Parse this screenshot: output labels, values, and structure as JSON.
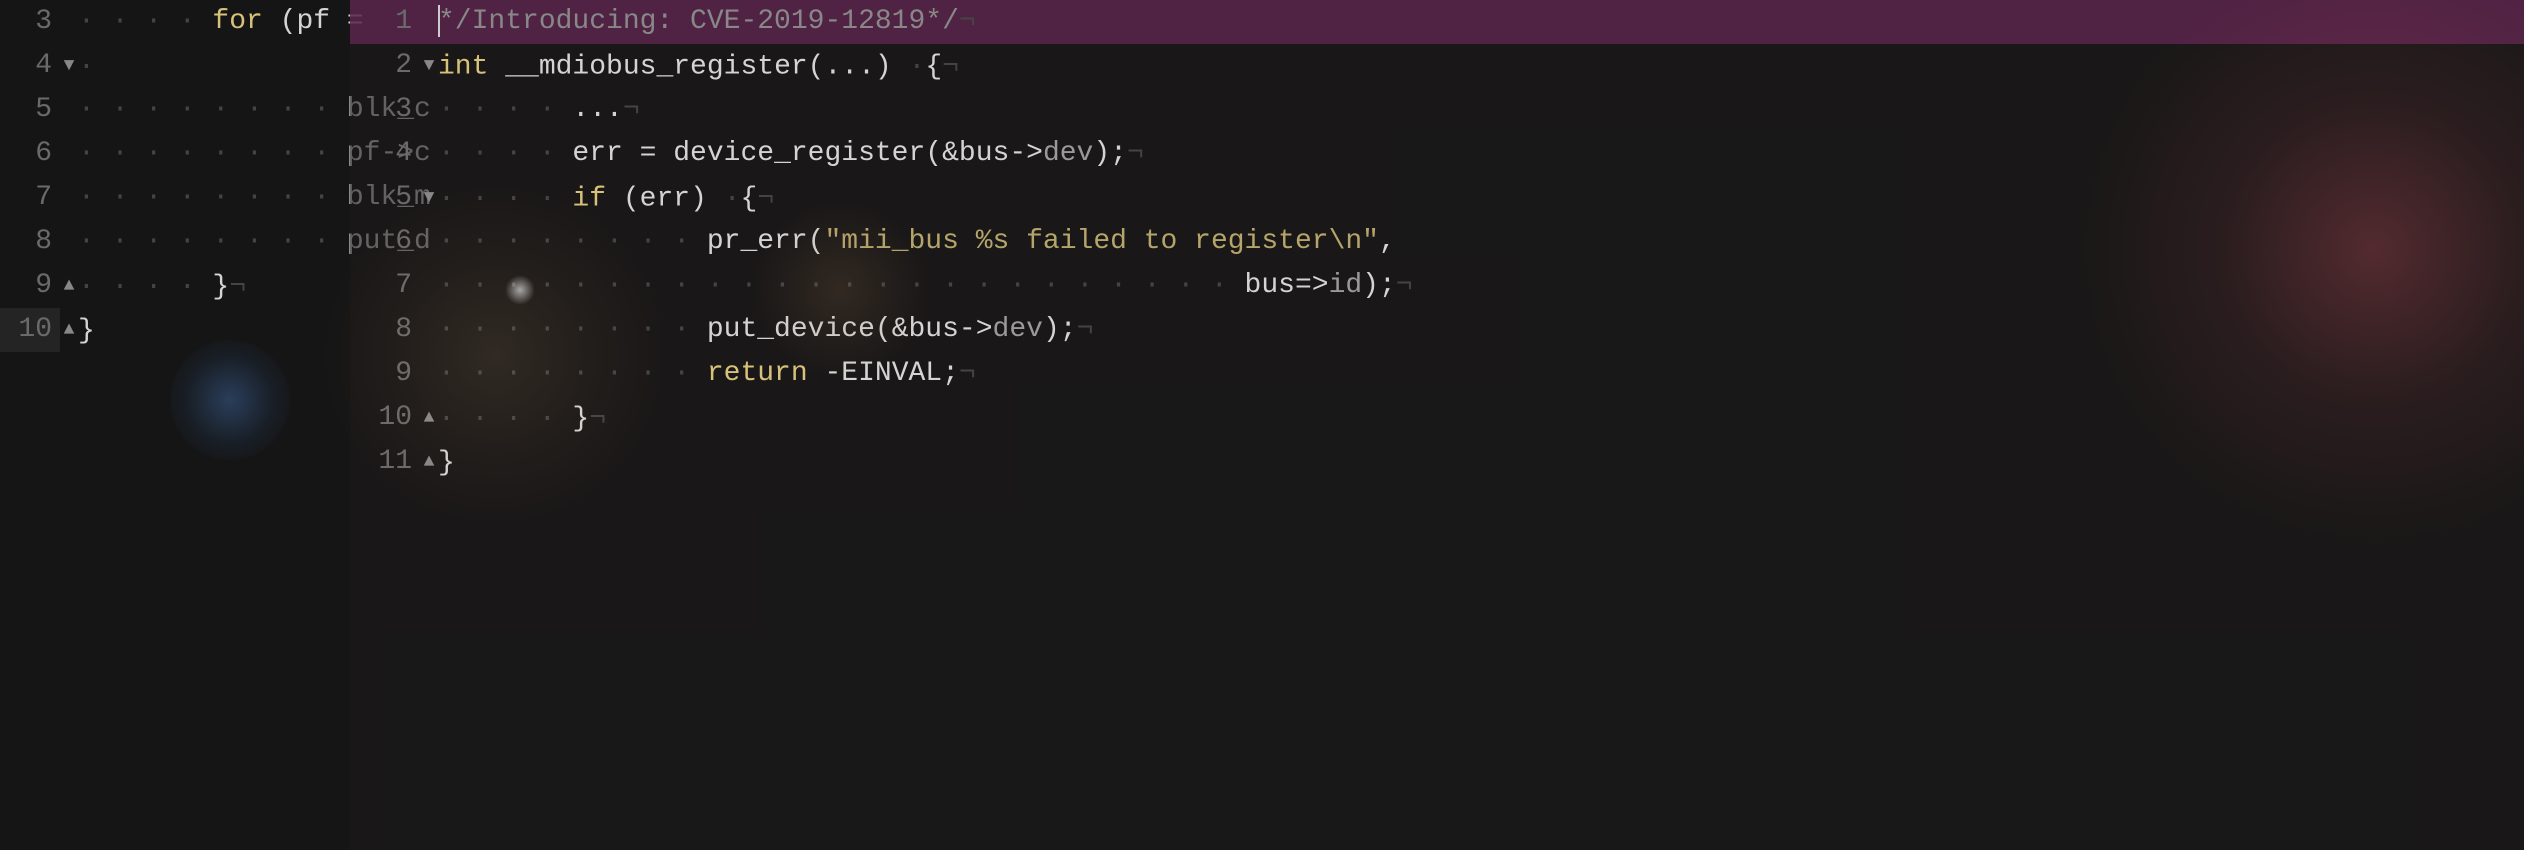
{
  "background_editor": {
    "lines": [
      {
        "num": "3",
        "fold": "",
        "tokens": [
          {
            "t": "ws",
            "v": "· · · · "
          },
          {
            "t": "kw",
            "v": "for "
          },
          {
            "t": "punct",
            "v": "(pf ="
          }
        ]
      },
      {
        "num": "4",
        "fold": "▼",
        "tokens": [
          {
            "t": "ws",
            "v": "· "
          }
        ]
      },
      {
        "num": "5",
        "fold": "",
        "tokens": [
          {
            "t": "ws",
            "v": "· · · · · · · · "
          },
          {
            "t": "ident",
            "v": "blk_c"
          }
        ]
      },
      {
        "num": "6",
        "fold": "",
        "tokens": [
          {
            "t": "ws",
            "v": "· · · · · · · · "
          },
          {
            "t": "ident",
            "v": "pf->c"
          }
        ]
      },
      {
        "num": "7",
        "fold": "",
        "tokens": [
          {
            "t": "ws",
            "v": "· · · · · · · · "
          },
          {
            "t": "ident",
            "v": "blk_m"
          }
        ]
      },
      {
        "num": "8",
        "fold": "",
        "tokens": [
          {
            "t": "ws",
            "v": "· · · · · · · · "
          },
          {
            "t": "ident",
            "v": "put_d"
          }
        ]
      },
      {
        "num": "9",
        "fold": "▲",
        "tokens": [
          {
            "t": "ws",
            "v": "· · · · "
          },
          {
            "t": "punct",
            "v": "}"
          },
          {
            "t": "ws",
            "v": "¬"
          }
        ]
      },
      {
        "num": "10",
        "fold": "▲",
        "tokens": [
          {
            "t": "punct",
            "v": "}"
          }
        ],
        "current": true
      }
    ]
  },
  "foreground_editor": {
    "lines": [
      {
        "num": "1",
        "fold": "",
        "highlight": true,
        "cursor": true,
        "tokens": [
          {
            "t": "comment",
            "v": "*/Introducing: CVE-2019-12819*/"
          },
          {
            "t": "ws",
            "v": "¬"
          }
        ]
      },
      {
        "num": "2",
        "fold": "▼",
        "tokens": [
          {
            "t": "type",
            "v": "int "
          },
          {
            "t": "fn",
            "v": "__mdiobus_register"
          },
          {
            "t": "punct",
            "v": "("
          },
          {
            "t": "op",
            "v": "..."
          },
          {
            "t": "punct",
            "v": ") "
          },
          {
            "t": "ws",
            "v": "·"
          },
          {
            "t": "punct",
            "v": "{"
          },
          {
            "t": "ws",
            "v": "¬"
          }
        ]
      },
      {
        "num": "3",
        "fold": "",
        "tokens": [
          {
            "t": "ws",
            "v": "· · · · "
          },
          {
            "t": "op",
            "v": "..."
          },
          {
            "t": "ws",
            "v": "¬"
          }
        ]
      },
      {
        "num": "4",
        "fold": "",
        "tokens": [
          {
            "t": "ws",
            "v": "· · · · "
          },
          {
            "t": "ident",
            "v": "err "
          },
          {
            "t": "op",
            "v": "= "
          },
          {
            "t": "fn",
            "v": "device_register"
          },
          {
            "t": "punct",
            "v": "("
          },
          {
            "t": "op",
            "v": "&"
          },
          {
            "t": "ident",
            "v": "bus"
          },
          {
            "t": "op",
            "v": "->"
          },
          {
            "t": "field",
            "v": "dev"
          },
          {
            "t": "punct",
            "v": ");"
          },
          {
            "t": "ws",
            "v": "¬"
          }
        ]
      },
      {
        "num": "5",
        "fold": "▼",
        "tokens": [
          {
            "t": "ws",
            "v": "· · · · "
          },
          {
            "t": "kw",
            "v": "if "
          },
          {
            "t": "punct",
            "v": "("
          },
          {
            "t": "ident",
            "v": "err"
          },
          {
            "t": "punct",
            "v": ") "
          },
          {
            "t": "ws",
            "v": "·"
          },
          {
            "t": "punct",
            "v": "{"
          },
          {
            "t": "ws",
            "v": "¬"
          }
        ]
      },
      {
        "num": "6",
        "fold": "",
        "tokens": [
          {
            "t": "ws",
            "v": "· · · · · · · · "
          },
          {
            "t": "fn",
            "v": "pr_err"
          },
          {
            "t": "punct",
            "v": "("
          },
          {
            "t": "str",
            "v": "\"mii_bus %s failed to register\\n\""
          },
          {
            "t": "punct",
            "v": ","
          }
        ]
      },
      {
        "num": "7",
        "fold": "",
        "tokens": [
          {
            "t": "ws",
            "v": "· · · · · · · · · · · · · · · · · · · · · · · · "
          },
          {
            "t": "ident",
            "v": "bus"
          },
          {
            "t": "op",
            "v": "=>"
          },
          {
            "t": "field",
            "v": "id"
          },
          {
            "t": "punct",
            "v": ");"
          },
          {
            "t": "ws",
            "v": "¬"
          }
        ]
      },
      {
        "num": "8",
        "fold": "",
        "tokens": [
          {
            "t": "ws",
            "v": "· · · · · · · · "
          },
          {
            "t": "fn",
            "v": "put_device"
          },
          {
            "t": "punct",
            "v": "("
          },
          {
            "t": "op",
            "v": "&"
          },
          {
            "t": "ident",
            "v": "bus"
          },
          {
            "t": "op",
            "v": "->"
          },
          {
            "t": "field",
            "v": "dev"
          },
          {
            "t": "punct",
            "v": ");"
          },
          {
            "t": "ws",
            "v": "¬"
          }
        ]
      },
      {
        "num": "9",
        "fold": "",
        "tokens": [
          {
            "t": "ws",
            "v": "· · · · · · · · "
          },
          {
            "t": "kw",
            "v": "return "
          },
          {
            "t": "op",
            "v": "-"
          },
          {
            "t": "const",
            "v": "EINVAL"
          },
          {
            "t": "punct",
            "v": ";"
          },
          {
            "t": "ws",
            "v": "¬"
          }
        ]
      },
      {
        "num": "10",
        "fold": "▲",
        "tokens": [
          {
            "t": "ws",
            "v": "· · · · "
          },
          {
            "t": "punct",
            "v": "}"
          },
          {
            "t": "ws",
            "v": "¬"
          }
        ]
      },
      {
        "num": "11",
        "fold": "▲",
        "tokens": [
          {
            "t": "punct",
            "v": "}"
          }
        ]
      }
    ]
  }
}
